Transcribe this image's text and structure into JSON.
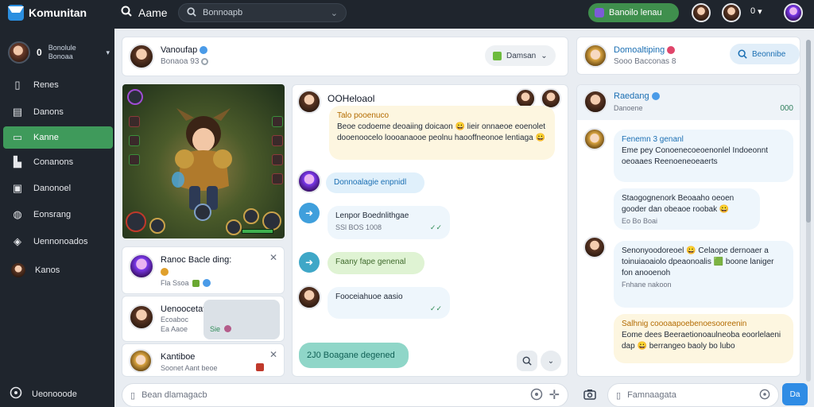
{
  "app": {
    "name": "Komunitan"
  },
  "topbar": {
    "section_title": "Aame",
    "search_placeholder": "Bonnoapb",
    "green_button_label": "Banoilo lenau",
    "user_menu_label": "0"
  },
  "sidebar": {
    "profile": {
      "line1": "Bonolule",
      "line2": "Bonoaa"
    },
    "items": [
      {
        "label": "Renes",
        "icon": "phone-icon"
      },
      {
        "label": "Danons",
        "icon": "bookmark-icon"
      },
      {
        "label": "Kanne",
        "icon": "folder-icon",
        "active": true
      },
      {
        "label": "Conanons",
        "icon": "people-icon"
      },
      {
        "label": "Danonoel",
        "icon": "image-icon"
      },
      {
        "label": "Eonsrang",
        "icon": "globe-icon"
      },
      {
        "label": "Uennonoados",
        "icon": "shield-icon"
      },
      {
        "label": "Kanos",
        "icon": "avatar-icon"
      }
    ],
    "bottom_status": "Ueonooode"
  },
  "feed": {
    "post": {
      "name": "Vanoufap",
      "sub": "Bonaoa 93",
      "button": "Damsan"
    },
    "list": [
      {
        "title": "Ranoc Bacle ding:",
        "meta": "Fla Ssoa"
      },
      {
        "title": "Uenoocetat ..on Dcenoe",
        "meta": "Ecoaboc",
        "meta2": "Ea Aaoe",
        "tag": "Sie"
      },
      {
        "title": "Kantiboe",
        "meta": "Soonet Aant beoe"
      }
    ]
  },
  "chat": {
    "title": "OOHeloaol",
    "messages": [
      {
        "heading": "Talo pooenuco",
        "body": "Beoe codoeme deoaiing doicaon 😀 lieir onnaeoe eoenolet dooenoocelo loooanaooe peolnu haooffneonoe lentiaga 😀"
      },
      {
        "text": "Donnoalagie enpnidl"
      },
      {
        "text": "Lenpor Boednlithgae",
        "meta": "SSl BOS 1008",
        "tick": "✓✓"
      },
      {
        "text": "Faany fape genenal"
      },
      {
        "text": "Fooceiahuoe aasio",
        "tick": "✓✓"
      },
      {
        "text": "2J0 Boagane degened"
      }
    ]
  },
  "right": {
    "header": {
      "name": "Domoaltiping",
      "sub": "Sooo Bacconas 8",
      "button": "Beonnibe"
    },
    "room": {
      "name": "Raedang",
      "sub": "Danoene",
      "count": "000"
    },
    "messages": [
      {
        "heading": "Fenemn 3 genanl",
        "body": "Eme pey Conoenecoeoenonlel Indoeonnt oeoaaes Reenoeneoeaerts"
      },
      {
        "body": "Staogognenork Beoaaho oeoen gooder dan obeaoe roobak 😀",
        "meta": "Eo Bo Boai"
      },
      {
        "body": "Senonyoodoreoel 😀 Celaope dernoaer a toinuiaoaiolo dpeaonoalis 🟩 boone laniger fon anooenoh",
        "meta": "Fnhane nakoon"
      },
      {
        "heading": "Salhnig coooaapoebenoesooreenin",
        "body": "Eome dees Beeraetionoaulneoba eoorlelaeni dap 😀 berrangeo baoly bo lubo"
      }
    ]
  },
  "inputs": {
    "left_placeholder": "Bean dlamagacb",
    "right_placeholder": "Famnaagata",
    "send_label": "Da"
  }
}
